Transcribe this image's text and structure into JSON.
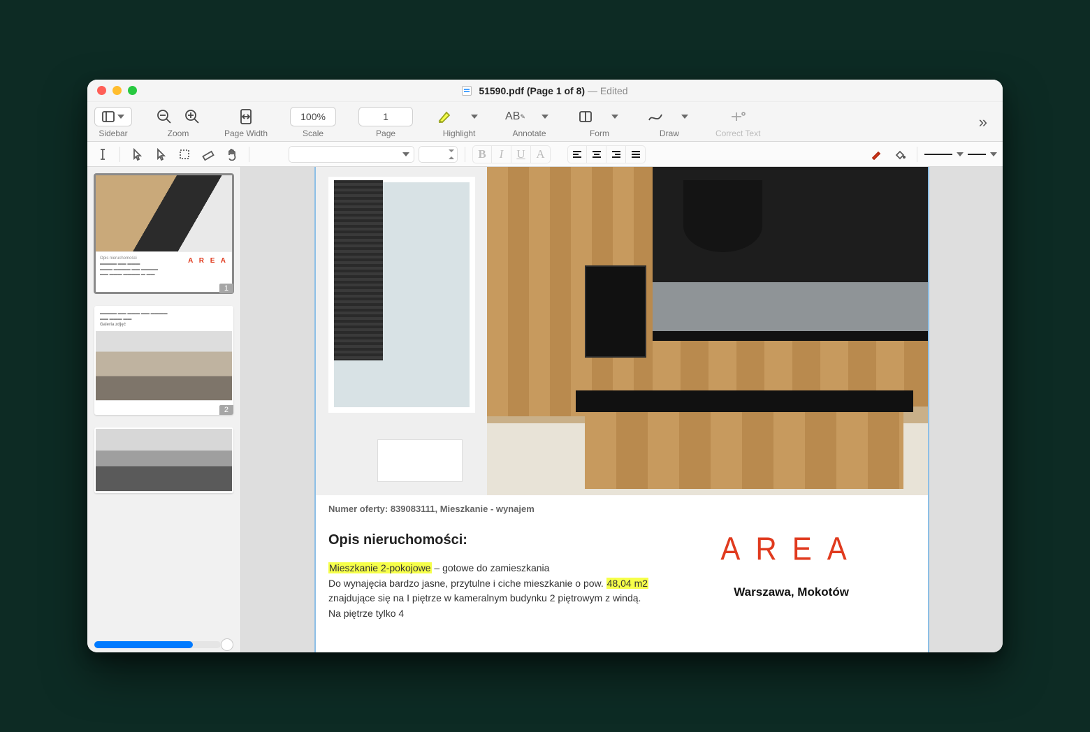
{
  "window": {
    "filename": "51590.pdf",
    "page_info": "(Page 1 of 8)",
    "status": "Edited"
  },
  "toolbar": {
    "sidebar": "Sidebar",
    "zoom": "Zoom",
    "pagewidth": "Page Width",
    "scale_label": "Scale",
    "scale_value": "100%",
    "page_label": "Page",
    "page_value": "1",
    "highlight": "Highlight",
    "annotate": "Annotate",
    "form": "Form",
    "draw": "Draw",
    "correct": "Correct Text"
  },
  "thumbs": {
    "p1": "1",
    "p2": "2"
  },
  "doc": {
    "offer_line": "Numer oferty: 839083111, Mieszkanie - wynajem",
    "heading": "Opis nieruchomości:",
    "hl1": "Mieszkanie 2-pokojowe",
    "t1": " – gotowe do zamieszkania",
    "t2a": "Do wynajęcia bardzo jasne, przytulne i ciche mieszkanie o pow. ",
    "hl2": "48,04 m2",
    "t2b": " znajdujące się na I piętrze w kameralnym budynku 2 piętrowym z windą. Na piętrze tylko 4",
    "brand": "AREA",
    "location": "Warszawa, Mokotów"
  }
}
